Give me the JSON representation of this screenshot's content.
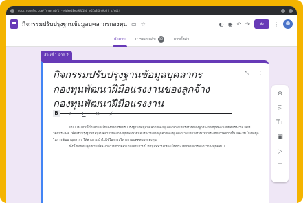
{
  "browser": {
    "url": "docs.google.com/forms/d/1r-hGpWeiEeg9Wb1bU_eOZu3KbrAbBj_b/edit"
  },
  "app": {
    "form_title": "กิจกรรมปรับปรุงฐานข้อมูลบุคลากรกองทุน",
    "folder_icon": "folder-icon",
    "star_icon": "star-icon",
    "send_label": "ส่ง",
    "accent_color": "#673ab7"
  },
  "tabs": [
    {
      "label": "คำถาม"
    },
    {
      "label": "การตอบกลับ"
    },
    {
      "label": "การตั้งค่า"
    }
  ],
  "responses_count": "36",
  "section": {
    "label": "ส่วนที่ 1 จาก 2",
    "title": "กิจกรรมปรับปรุงฐานข้อมูลบุคลากรกองทุนพัฒนาฝีมือแรงงานของลูกจ้างกองทุนพัฒนาฝีมือแรงงาน",
    "description_p1": "แบบประเมินนี้เป็นส่วนหนึ่งของกิจกรรมปรับปรุงฐานข้อมูลบุคลากรกองทุนพัฒนาฝีมือแรงงานของลูกจ้างกองทุนพัฒนาฝีมือแรงงาน โดยมีวัตถุประสงค์ เพื่อปรับปรุงฐานข้อมูลบุคลากรของกองทุนพัฒนาฝีมือแรงงานของลูกจ้างกองทุนพัฒนาฝีมือแรงงานให้มีประสิทธิภาพมากขึ้น และใช้เป็นข้อมูลในการพัฒนาบุคลากร ให้สามารถนำไปใช้ในการบริหารงานบุคคลของกองทุน",
    "description_p2": "ทั้งนี้ ขอขอบคุณท่านที่สละเวลาในการตอบแบบสอบถามนี้ ข้อมูลที่ท่านให้จะเป็นประโยชน์ต่อการพัฒนากองทุนต่อไป"
  },
  "format_buttons": [
    "B",
    "I",
    "U",
    "⊝",
    "T̸"
  ]
}
